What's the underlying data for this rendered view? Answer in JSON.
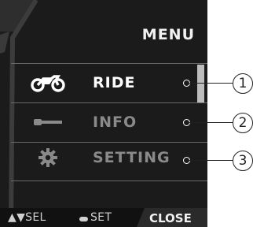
{
  "header": {
    "title": "MENU"
  },
  "menu": {
    "items": [
      {
        "label": "RIDE",
        "icon": "motorcycle-icon",
        "selected": true,
        "callout": "1"
      },
      {
        "label": "INFO",
        "icon": "wrench-icon",
        "selected": false,
        "callout": "2"
      },
      {
        "label": "SETTING",
        "icon": "gear-icon",
        "selected": false,
        "callout": "3"
      }
    ]
  },
  "footer": {
    "sel_label": "▲▼SEL",
    "set_label": "SET",
    "close_label": "CLOSE"
  },
  "colors": {
    "background": "#1b1b1b",
    "selected_text": "#ffffff",
    "inactive_text": "#8a8a8a",
    "divider": "#6a6a6a"
  }
}
